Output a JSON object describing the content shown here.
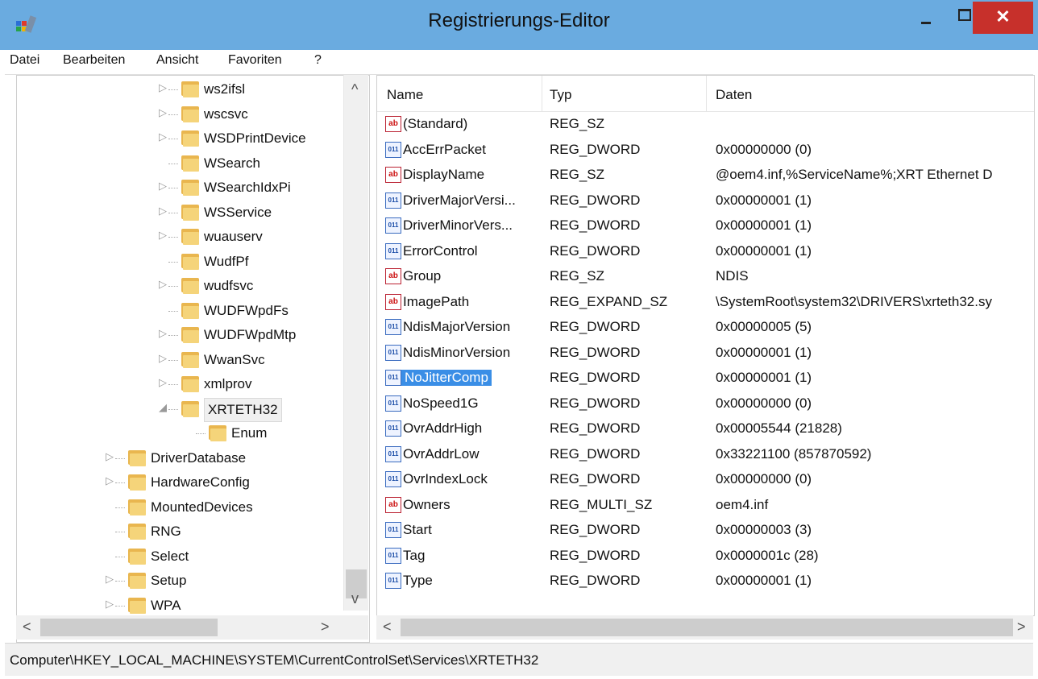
{
  "window": {
    "title": "Registrierungs-Editor",
    "close_glyph": "✕"
  },
  "menu": [
    "Datei",
    "Bearbeiten",
    "Ansicht",
    "Favoriten",
    "?"
  ],
  "tree": [
    {
      "label": "ws2ifsl",
      "exp": "▷"
    },
    {
      "label": "wscsvc",
      "exp": "▷"
    },
    {
      "label": "WSDPrintDevice",
      "exp": "▷"
    },
    {
      "label": "WSearch",
      "exp": ""
    },
    {
      "label": "WSearchIdxPi",
      "exp": "▷"
    },
    {
      "label": "WSService",
      "exp": "▷"
    },
    {
      "label": "wuauserv",
      "exp": "▷"
    },
    {
      "label": "WudfPf",
      "exp": ""
    },
    {
      "label": "wudfsvc",
      "exp": "▷"
    },
    {
      "label": "WUDFWpdFs",
      "exp": ""
    },
    {
      "label": "WUDFWpdMtp",
      "exp": "▷"
    },
    {
      "label": "WwanSvc",
      "exp": "▷"
    },
    {
      "label": "xmlprov",
      "exp": "▷"
    },
    {
      "label": "XRTETH32",
      "exp": "◢"
    },
    {
      "label": "Enum",
      "exp": ""
    },
    {
      "label": "DriverDatabase",
      "exp": "▷"
    },
    {
      "label": "HardwareConfig",
      "exp": "▷"
    },
    {
      "label": "MountedDevices",
      "exp": ""
    },
    {
      "label": "RNG",
      "exp": ""
    },
    {
      "label": "Select",
      "exp": ""
    },
    {
      "label": "Setup",
      "exp": "▷"
    },
    {
      "label": "WPA",
      "exp": "▷"
    }
  ],
  "columns": {
    "name": "Name",
    "type": "Typ",
    "data": "Daten"
  },
  "values": [
    {
      "icon": "ab",
      "name": "(Standard)",
      "type": "REG_SZ",
      "data": ""
    },
    {
      "icon": "bin",
      "name": "AccErrPacket",
      "type": "REG_DWORD",
      "data": "0x00000000 (0)"
    },
    {
      "icon": "ab",
      "name": "DisplayName",
      "type": "REG_SZ",
      "data": "@oem4.inf,%ServiceName%;XRT Ethernet D"
    },
    {
      "icon": "bin",
      "name": "DriverMajorVersi...",
      "type": "REG_DWORD",
      "data": "0x00000001 (1)"
    },
    {
      "icon": "bin",
      "name": "DriverMinorVers...",
      "type": "REG_DWORD",
      "data": "0x00000001 (1)"
    },
    {
      "icon": "bin",
      "name": "ErrorControl",
      "type": "REG_DWORD",
      "data": "0x00000001 (1)"
    },
    {
      "icon": "ab",
      "name": "Group",
      "type": "REG_SZ",
      "data": "NDIS"
    },
    {
      "icon": "ab",
      "name": "ImagePath",
      "type": "REG_EXPAND_SZ",
      "data": "\\SystemRoot\\system32\\DRIVERS\\xrteth32.sy"
    },
    {
      "icon": "bin",
      "name": "NdisMajorVersion",
      "type": "REG_DWORD",
      "data": "0x00000005 (5)"
    },
    {
      "icon": "bin",
      "name": "NdisMinorVersion",
      "type": "REG_DWORD",
      "data": "0x00000001 (1)"
    },
    {
      "icon": "bin",
      "name": "NoJitterComp",
      "type": "REG_DWORD",
      "data": "0x00000001 (1)"
    },
    {
      "icon": "bin",
      "name": "NoSpeed1G",
      "type": "REG_DWORD",
      "data": "0x00000000 (0)"
    },
    {
      "icon": "bin",
      "name": "OvrAddrHigh",
      "type": "REG_DWORD",
      "data": "0x00005544 (21828)"
    },
    {
      "icon": "bin",
      "name": "OvrAddrLow",
      "type": "REG_DWORD",
      "data": "0x33221100 (857870592)"
    },
    {
      "icon": "bin",
      "name": "OvrIndexLock",
      "type": "REG_DWORD",
      "data": "0x00000000 (0)"
    },
    {
      "icon": "ab",
      "name": "Owners",
      "type": "REG_MULTI_SZ",
      "data": "oem4.inf"
    },
    {
      "icon": "bin",
      "name": "Start",
      "type": "REG_DWORD",
      "data": "0x00000003 (3)"
    },
    {
      "icon": "bin",
      "name": "Tag",
      "type": "REG_DWORD",
      "data": "0x0000001c (28)"
    },
    {
      "icon": "bin",
      "name": "Type",
      "type": "REG_DWORD",
      "data": "0x00000001 (1)"
    }
  ],
  "selected_value": "NoJitterComp",
  "selected_key": "XRTETH32",
  "icon_text": {
    "ab": "ab",
    "bin": "011"
  },
  "scroll": {
    "up": "^",
    "down": "v",
    "left": "<",
    "right": ">"
  },
  "statusbar": {
    "path": "Computer\\HKEY_LOCAL_MACHINE\\SYSTEM\\CurrentControlSet\\Services\\XRTETH32"
  }
}
